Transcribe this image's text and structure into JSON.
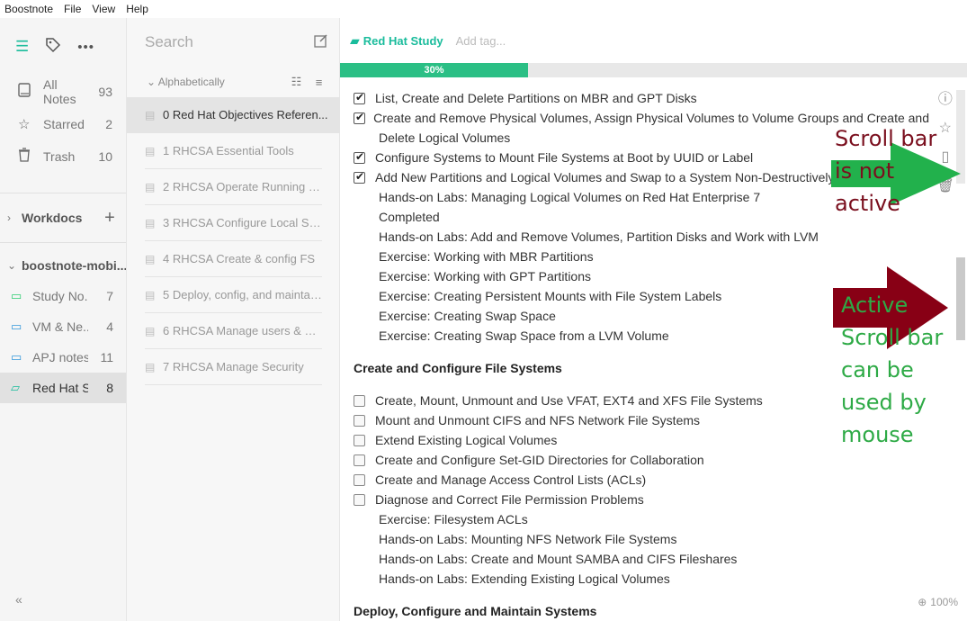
{
  "menubar": {
    "items": [
      "Boostnote",
      "File",
      "View",
      "Help"
    ]
  },
  "sidebar": {
    "nav": [
      {
        "icon": "book-icon",
        "label": "All Notes",
        "count": "93"
      },
      {
        "icon": "star-icon",
        "label": "Starred",
        "count": "2"
      },
      {
        "icon": "trash-icon",
        "label": "Trash",
        "count": "10"
      }
    ],
    "storages": [
      {
        "name": "Workdocs",
        "expanded": false
      },
      {
        "name": "boostnote-mobi...",
        "expanded": true
      }
    ],
    "folders": [
      {
        "label": "Study No...",
        "count": "7",
        "color": "#2ecc71"
      },
      {
        "label": "VM & Ne...",
        "count": "4",
        "color": "#3498db"
      },
      {
        "label": "APJ notes",
        "count": "11",
        "color": "#3498db"
      },
      {
        "label": "Red Hat S...",
        "count": "8",
        "color": "#1abc9c",
        "active": true
      }
    ],
    "collapse": "«"
  },
  "notelist": {
    "search_placeholder": "Search",
    "sort_label": "Alphabetically",
    "items": [
      "0 Red Hat Objectives Referen...",
      "1 RHCSA Essential Tools",
      "2 RHCSA Operate Running S...",
      "3 RHCSA Configure Local Sto...",
      "4 RHCSA Create & config FS",
      "5 Deploy, config, and maintai...",
      "6 RHCSA Manage users & Gr...",
      "7 RHCSA Manage Security"
    ]
  },
  "editor": {
    "folder": "Red Hat Study",
    "tag_placeholder": "Add tag...",
    "progress": 0.3,
    "progress_label": "30%",
    "zoom": "100%",
    "lines": [
      {
        "type": "task",
        "checked": true,
        "text": "List, Create and Delete Partitions on MBR and GPT Disks"
      },
      {
        "type": "task",
        "checked": true,
        "text": "Create and Remove Physical Volumes, Assign Physical Volumes to Volume Groups and Create and"
      },
      {
        "type": "sub",
        "text": "Delete Logical Volumes"
      },
      {
        "type": "task",
        "checked": true,
        "text": "Configure Systems to Mount File Systems at Boot by UUID or Label"
      },
      {
        "type": "task",
        "checked": true,
        "text": "Add New Partitions and Logical Volumes and Swap to a System Non-Destructively"
      },
      {
        "type": "sub",
        "text": "Hands-on Labs: Managing Logical Volumes on Red Hat Enterprise 7"
      },
      {
        "type": "sub",
        "text": "Completed"
      },
      {
        "type": "sub",
        "text": "Hands-on Labs: Add and Remove Volumes, Partition Disks and Work with LVM"
      },
      {
        "type": "sub",
        "text": "Exercise: Working with MBR Partitions"
      },
      {
        "type": "sub",
        "text": "Exercise: Working with GPT Partitions"
      },
      {
        "type": "sub",
        "text": "Exercise: Creating Persistent Mounts with File System Labels"
      },
      {
        "type": "sub",
        "text": "Exercise: Creating Swap Space"
      },
      {
        "type": "sub",
        "text": "Exercise: Creating Swap Space from a LVM Volume"
      },
      {
        "type": "gap"
      },
      {
        "type": "heading",
        "text": "Create and Configure File Systems"
      },
      {
        "type": "gap"
      },
      {
        "type": "task",
        "checked": false,
        "text": "Create, Mount, Unmount and Use VFAT, EXT4 and XFS File Systems"
      },
      {
        "type": "task",
        "checked": false,
        "text": "Mount and Unmount CIFS and NFS Network File Systems"
      },
      {
        "type": "task",
        "checked": false,
        "text": "Extend Existing Logical Volumes"
      },
      {
        "type": "task",
        "checked": false,
        "text": "Create and Configure Set-GID Directories for Collaboration"
      },
      {
        "type": "task",
        "checked": false,
        "text": "Create and Manage Access Control Lists (ACLs)"
      },
      {
        "type": "task",
        "checked": false,
        "text": "Diagnose and Correct File Permission Problems"
      },
      {
        "type": "sub",
        "text": "Exercise: Filesystem ACLs"
      },
      {
        "type": "sub",
        "text": "Hands-on Labs: Mounting NFS Network File Systems"
      },
      {
        "type": "sub",
        "text": "Hands-on Labs: Create and Mount SAMBA and CIFS Fileshares"
      },
      {
        "type": "sub",
        "text": "Hands-on Labs: Extending Existing Logical Volumes"
      },
      {
        "type": "gap"
      },
      {
        "type": "heading",
        "text": "Deploy, Configure and Maintain Systems"
      }
    ]
  },
  "annotations": {
    "inactive": "Scroll bar\nis not\nactive",
    "active": "Active\nScroll bar\ncan be\nused by\nmouse",
    "colors": {
      "inactive_text": "#7a0f1e",
      "active_text": "#2eaa46",
      "green_arrow": "#22b14c",
      "red_arrow": "#880015"
    }
  }
}
